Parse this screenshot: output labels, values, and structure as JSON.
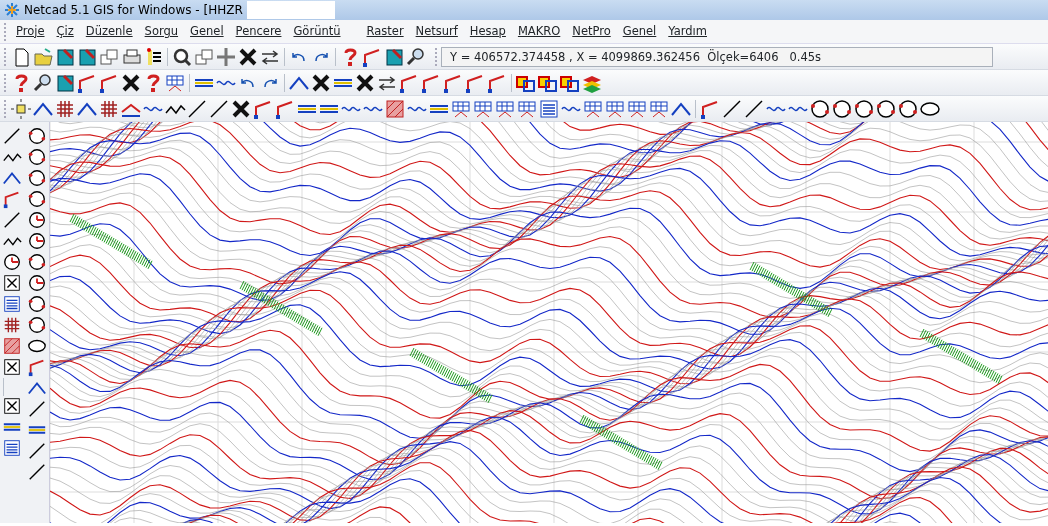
{
  "window": {
    "title": "Netcad 5.1 GIS for Windows - [HHZR"
  },
  "menu": [
    {
      "label": "Proje"
    },
    {
      "label": "Çiz"
    },
    {
      "label": "Düzenle"
    },
    {
      "label": "Sorgu"
    },
    {
      "label": "Genel"
    },
    {
      "label": "Pencere"
    },
    {
      "label": "Görüntü"
    },
    {
      "label": "Raster"
    },
    {
      "label": "Netsurf"
    },
    {
      "label": "Hesap"
    },
    {
      "label": "MAKRO"
    },
    {
      "label": "NetPro"
    },
    {
      "label": "Genel"
    },
    {
      "label": "Yardım"
    }
  ],
  "status_field": {
    "value": "Y = 406572.374458 , X = 4099869.362456  Ölçek=6406   0.45s"
  }
}
